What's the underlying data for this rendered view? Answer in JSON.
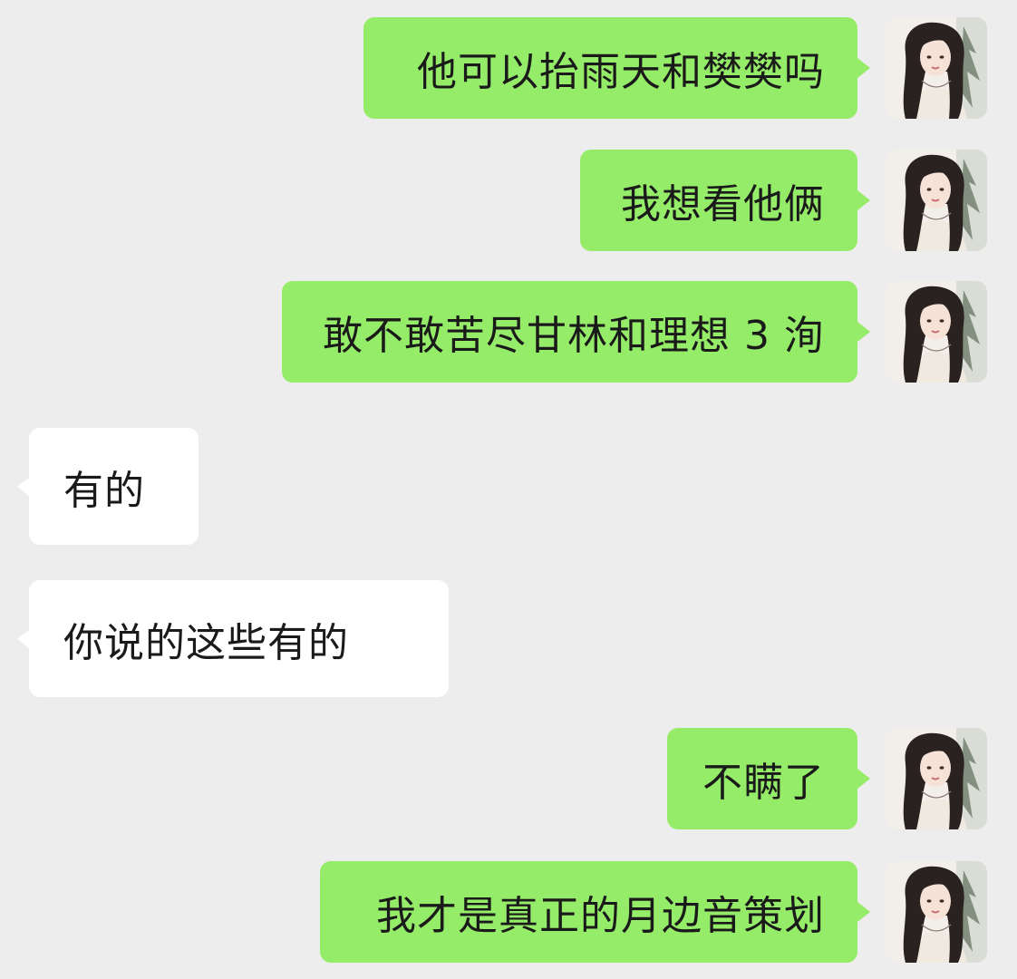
{
  "conversation": {
    "messages": [
      {
        "direction": "sent",
        "text": "他可以抬雨天和樊樊吗"
      },
      {
        "direction": "sent",
        "text": "我想看他俩"
      },
      {
        "direction": "sent",
        "text": "敢不敢苦尽甘林和理想 3 洵"
      },
      {
        "direction": "received",
        "text": "有的"
      },
      {
        "direction": "received",
        "text": "你说的这些有的"
      },
      {
        "direction": "sent",
        "text": "不瞒了"
      },
      {
        "direction": "sent",
        "text": "我才是真正的月边音策划"
      }
    ]
  },
  "colors": {
    "background": "#ededed",
    "sent_bubble": "#95ec69",
    "received_bubble": "#ffffff",
    "text": "#1a1a1a"
  },
  "icons": {
    "avatar": "user-avatar-photo"
  }
}
